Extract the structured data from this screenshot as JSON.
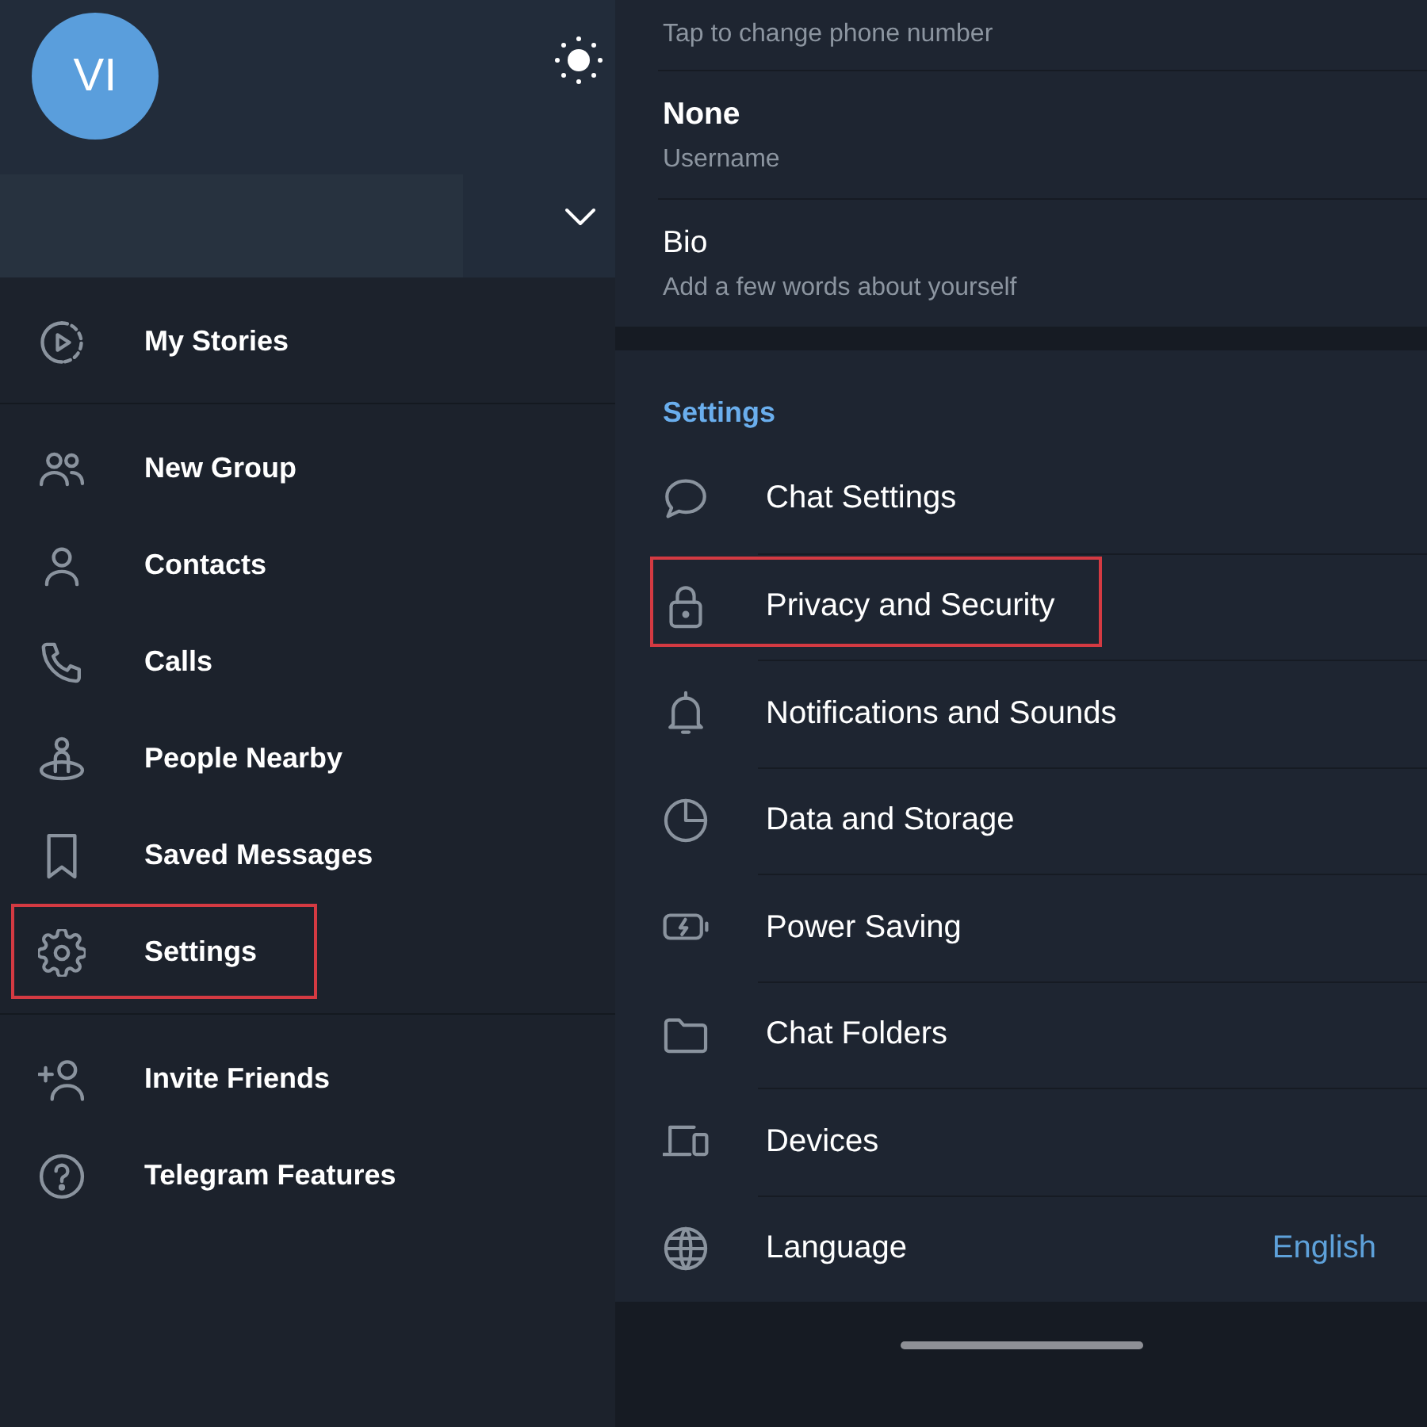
{
  "drawer": {
    "avatar_initials": "VI",
    "sections": [
      {
        "items": [
          {
            "kind": "stories",
            "label": "My Stories",
            "highlighted": false
          }
        ]
      },
      {
        "items": [
          {
            "kind": "group",
            "label": "New Group",
            "highlighted": false
          },
          {
            "kind": "contacts",
            "label": "Contacts",
            "highlighted": false
          },
          {
            "kind": "calls",
            "label": "Calls",
            "highlighted": false
          },
          {
            "kind": "nearby",
            "label": "People Nearby",
            "highlighted": false
          },
          {
            "kind": "saved",
            "label": "Saved Messages",
            "highlighted": false
          },
          {
            "kind": "settings",
            "label": "Settings",
            "highlighted": true
          }
        ]
      },
      {
        "items": [
          {
            "kind": "invite",
            "label": "Invite Friends",
            "highlighted": false
          },
          {
            "kind": "features",
            "label": "Telegram Features",
            "highlighted": false
          }
        ]
      }
    ]
  },
  "account": {
    "phone_hint": "Tap to change phone number",
    "fields": [
      {
        "kind": "username",
        "value": "None",
        "caption": "Username"
      },
      {
        "kind": "bio",
        "value": "Bio",
        "caption": "Add a few words about yourself"
      }
    ]
  },
  "settings": {
    "title": "Settings",
    "items": [
      {
        "kind": "chat",
        "label": "Chat Settings",
        "highlighted": false
      },
      {
        "kind": "privacy",
        "label": "Privacy and Security",
        "highlighted": true
      },
      {
        "kind": "notifications",
        "label": "Notifications and Sounds",
        "highlighted": false
      },
      {
        "kind": "data",
        "label": "Data and Storage",
        "highlighted": false
      },
      {
        "kind": "power",
        "label": "Power Saving",
        "highlighted": false
      },
      {
        "kind": "folders",
        "label": "Chat Folders",
        "highlighted": false
      },
      {
        "kind": "devices",
        "label": "Devices",
        "highlighted": false
      },
      {
        "kind": "language",
        "label": "Language",
        "value": "English",
        "highlighted": false
      }
    ]
  }
}
